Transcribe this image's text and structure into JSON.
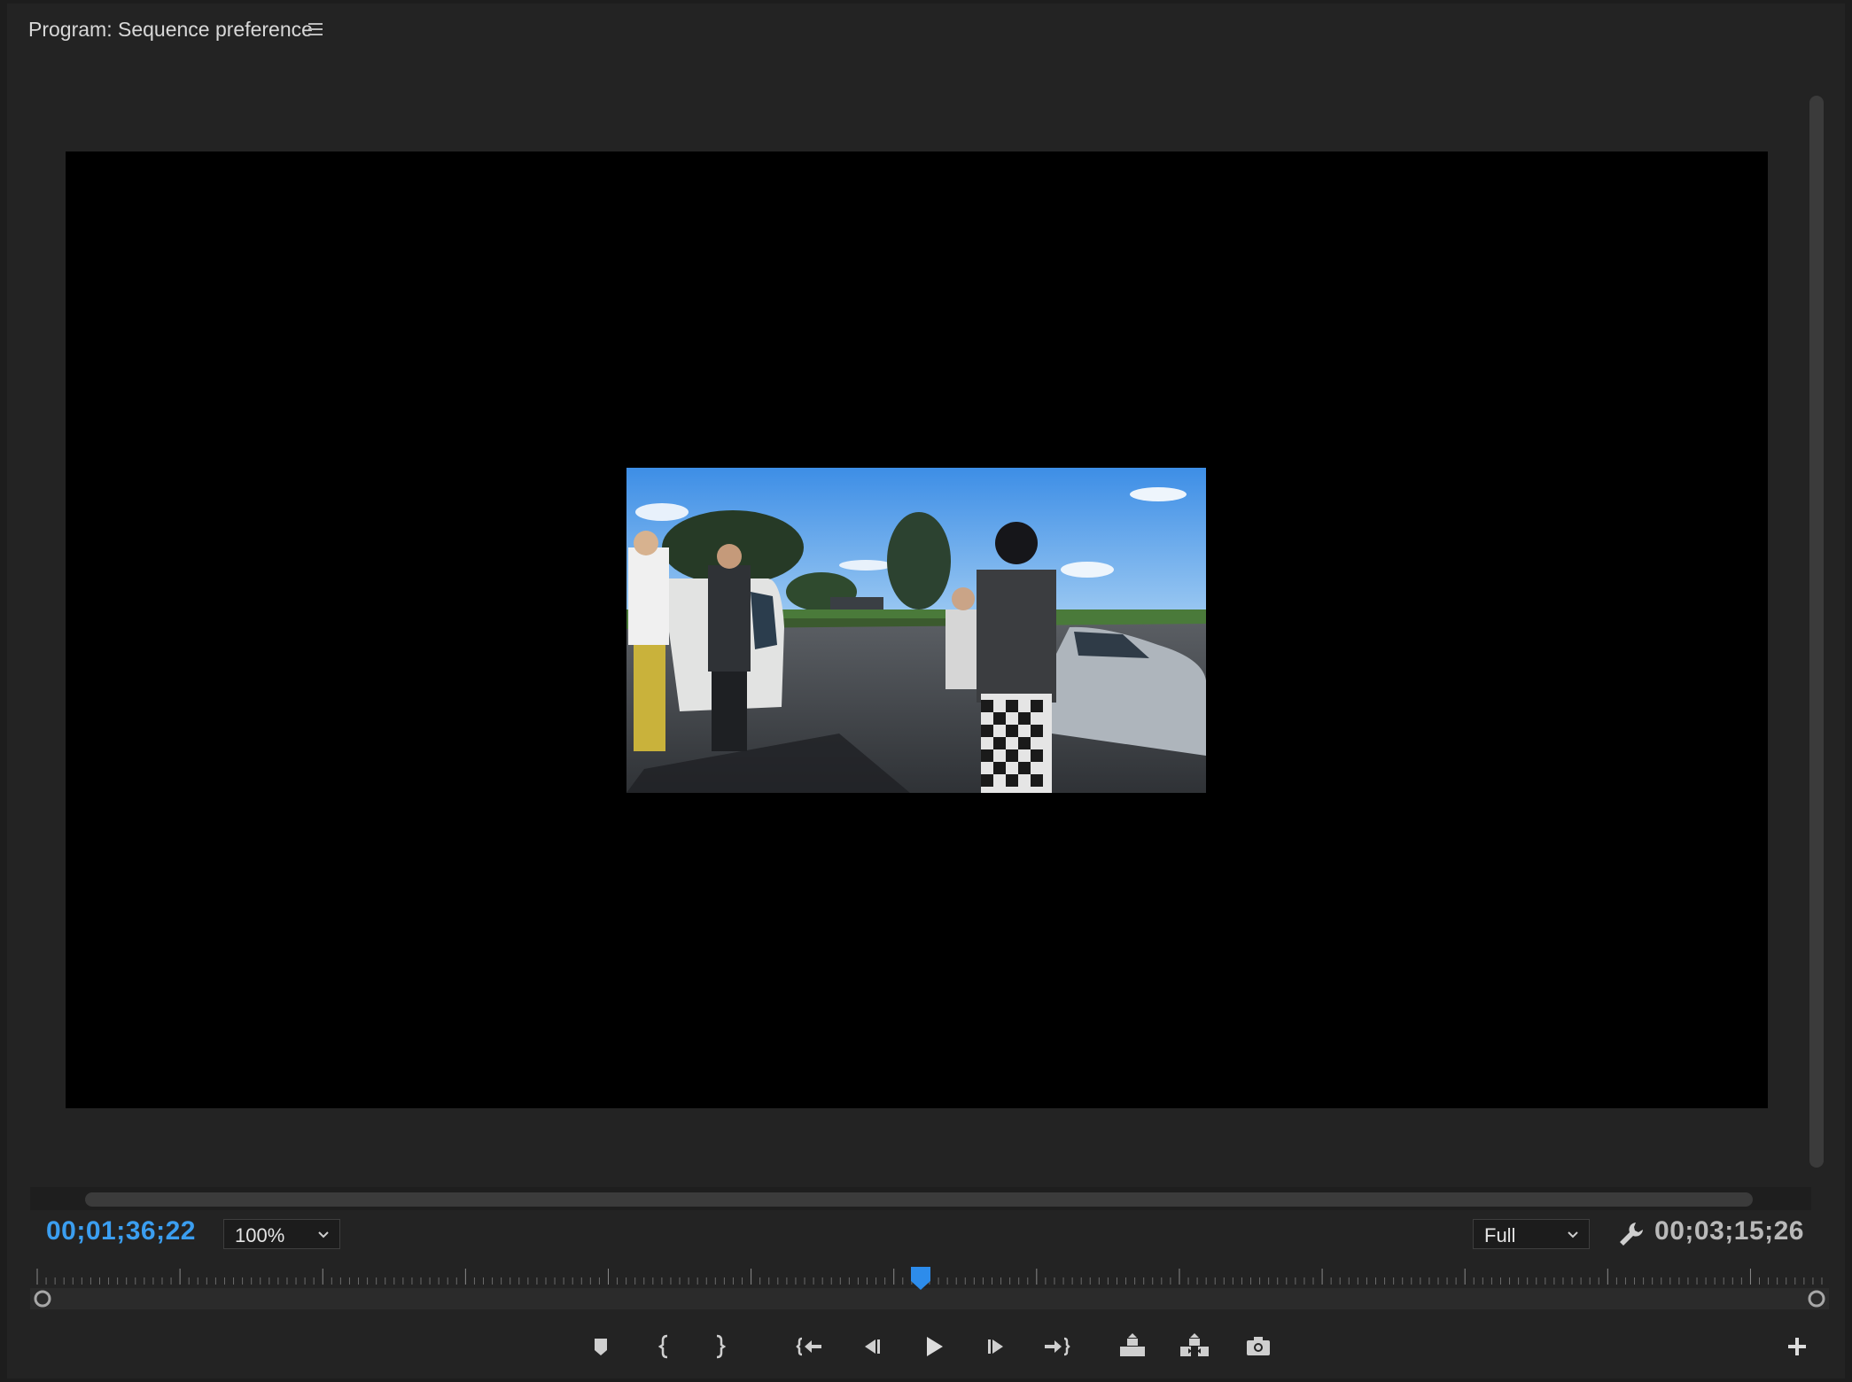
{
  "panel": {
    "title": "Program: Sequence preference",
    "menu_icon": "hamburger-icon"
  },
  "viewer": {
    "frame_description_icon": "video-frame"
  },
  "timecode": {
    "current": "00;01;36;22",
    "duration": "00;03;15;26",
    "current_color": "#3b9ef0"
  },
  "zoom": {
    "value": "100%"
  },
  "resolution": {
    "value": "Full"
  },
  "playhead": {
    "position_fraction": 0.495,
    "color": "#2d8ceb"
  },
  "controls": [
    {
      "name": "add-marker-button",
      "icon": "marker-icon"
    },
    {
      "name": "mark-in-button",
      "icon": "mark-in-icon"
    },
    {
      "name": "mark-out-button",
      "icon": "mark-out-icon"
    },
    {
      "name": "go-to-in-button",
      "icon": "go-to-in-icon"
    },
    {
      "name": "step-back-button",
      "icon": "step-back-icon"
    },
    {
      "name": "play-button",
      "icon": "play-icon"
    },
    {
      "name": "step-forward-button",
      "icon": "step-forward-icon"
    },
    {
      "name": "go-to-out-button",
      "icon": "go-to-out-icon"
    },
    {
      "name": "lift-button",
      "icon": "lift-icon"
    },
    {
      "name": "extract-button",
      "icon": "extract-icon"
    },
    {
      "name": "export-frame-button",
      "icon": "camera-icon"
    },
    {
      "name": "button-editor-button",
      "icon": "plus-icon"
    }
  ]
}
